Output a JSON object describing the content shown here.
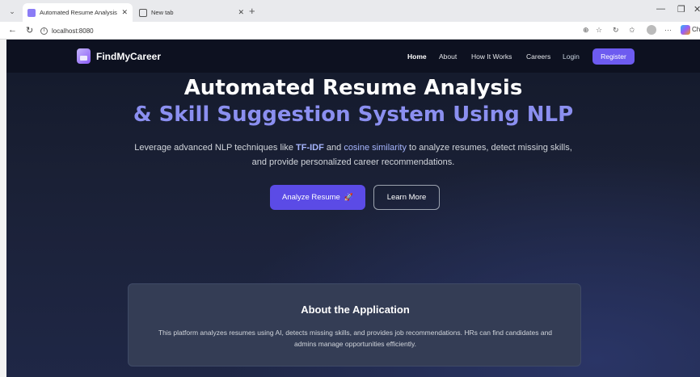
{
  "browser": {
    "tabs": [
      {
        "title": "Automated Resume Analysis & Ski",
        "active": true
      },
      {
        "title": "New tab",
        "active": false
      }
    ],
    "url": "localhost:8080",
    "new_tab_symbol": "+",
    "close_symbol": "✕",
    "copilot_label": "Ch"
  },
  "navbar": {
    "brand": "FindMyCareer",
    "links": [
      "Home",
      "About",
      "How It Works",
      "Careers",
      "Login"
    ],
    "register_label": "Register"
  },
  "hero": {
    "title_line1": "Automated Resume Analysis",
    "title_line2": "& Skill Suggestion System Using NLP",
    "desc_part1": "Leverage advanced NLP techniques like ",
    "desc_hl1": "TF-IDF",
    "desc_part2": " and ",
    "desc_hl2": "cosine similarity",
    "desc_part3": " to analyze resumes, detect missing skills, and provide personalized career recommendations.",
    "analyze_label": "Analyze Resume",
    "analyze_icon": "rocket-icon",
    "learn_label": "Learn More"
  },
  "about": {
    "title": "About the Application",
    "text": "This platform analyzes resumes using AI, detects missing skills, and provides job recommendations. HRs can find candidates and admins manage opportunities efficiently."
  },
  "colors": {
    "accent": "#5b4be6",
    "title_accent": "#8b8ff0",
    "page_bg": "#1a2035"
  }
}
